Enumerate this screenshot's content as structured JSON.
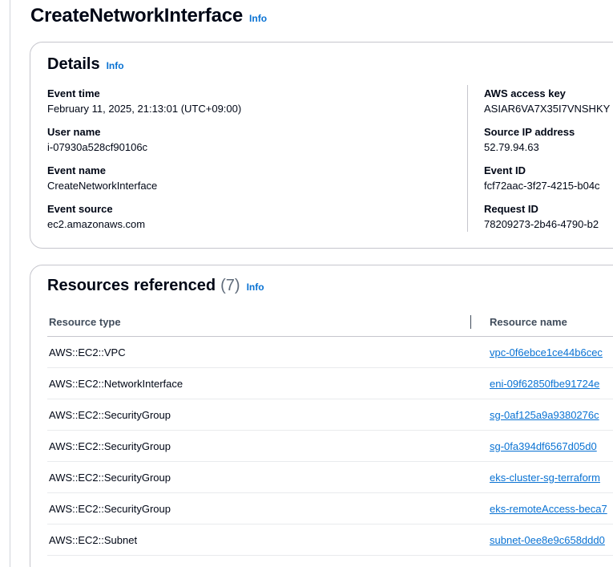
{
  "header": {
    "title": "CreateNetworkInterface",
    "info_label": "Info"
  },
  "details": {
    "title": "Details",
    "info_label": "Info",
    "left": [
      {
        "label": "Event time",
        "value": "February 11, 2025, 21:13:01 (UTC+09:00)"
      },
      {
        "label": "User name",
        "value": "i-07930a528cf90106c"
      },
      {
        "label": "Event name",
        "value": "CreateNetworkInterface"
      },
      {
        "label": "Event source",
        "value": "ec2.amazonaws.com"
      }
    ],
    "right": [
      {
        "label": "AWS access key",
        "value": "ASIAR6VA7X35I7VNSHKY"
      },
      {
        "label": "Source IP address",
        "value": "52.79.94.63"
      },
      {
        "label": "Event ID",
        "value": "fcf72aac-3f27-4215-b04c"
      },
      {
        "label": "Request ID",
        "value": "78209273-2b46-4790-b2"
      }
    ]
  },
  "resources": {
    "title": "Resources referenced",
    "count": "(7)",
    "info_label": "Info",
    "columns": [
      "Resource type",
      "Resource name"
    ],
    "rows": [
      {
        "type": "AWS::EC2::VPC",
        "name": "vpc-0f6ebce1ce44b6cec"
      },
      {
        "type": "AWS::EC2::NetworkInterface",
        "name": "eni-09f62850fbe91724e"
      },
      {
        "type": "AWS::EC2::SecurityGroup",
        "name": "sg-0af125a9a9380276c"
      },
      {
        "type": "AWS::EC2::SecurityGroup",
        "name": "sg-0fa394df6567d05d0"
      },
      {
        "type": "AWS::EC2::SecurityGroup",
        "name": "eks-cluster-sg-terraform"
      },
      {
        "type": "AWS::EC2::SecurityGroup",
        "name": "eks-remoteAccess-beca7"
      },
      {
        "type": "AWS::EC2::Subnet",
        "name": "subnet-0ee8e9c658ddd0"
      }
    ]
  },
  "colors": {
    "link": "#0972d3",
    "text": "#000716",
    "border": "#c6c6cd",
    "muted": "#5f6b7a"
  }
}
